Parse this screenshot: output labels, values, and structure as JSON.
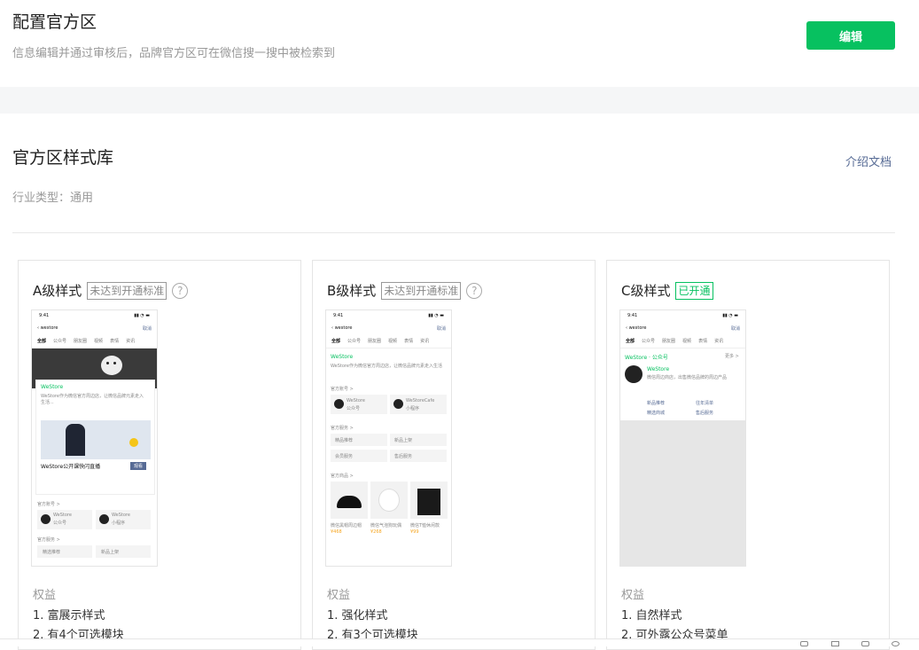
{
  "header": {
    "title": "配置官方区",
    "subtitle": "信息编辑并通过审核后，品牌官方区可在微信搜一搜中被检索到",
    "edit_label": "编辑"
  },
  "library": {
    "title": "官方区样式库",
    "doc_link": "介绍文档",
    "industry": "行业类型：通用"
  },
  "phone": {
    "time": "9:41",
    "nav_back": "westore",
    "nav_cancel": "取消",
    "tabs": [
      "全部",
      "公众号",
      "朋友圈",
      "视频",
      "表情",
      "资讯"
    ]
  },
  "cards": [
    {
      "title": "A级样式",
      "badge": "未达到开通标准",
      "help": "?",
      "rights_label": "权益",
      "rights": [
        "1. 富展示样式",
        "2. 有4个可选模块"
      ],
      "preview": {
        "brand": "WeStore",
        "desc": "WeStore作为微信官方周边店，让微信品牌元素走入生活...",
        "live_title": "WeStore公开课快闪直播",
        "live_btn": "观看",
        "accounts_label": "官方账号 >",
        "account1": "WeStore",
        "account1_sub": "公众号",
        "account2": "WeStore",
        "account2_sub": "小程序",
        "services_label": "官方服务 >",
        "service1": "精选推荐",
        "service2": "新品上架"
      }
    },
    {
      "title": "B级样式",
      "badge": "未达到开通标准",
      "help": "?",
      "rights_label": "权益",
      "rights": [
        "1. 强化样式",
        "2. 有3个可选模块"
      ],
      "preview": {
        "brand": "WeStore",
        "desc": "WeStore作为微信官方周边店，让微信品牌元素走入生活",
        "accounts_label": "官方账号 >",
        "account1": "WeStore",
        "account1_sub": "公众号",
        "account2": "WeStoreCafe",
        "account2_sub": "小程序",
        "services_label": "官方服务 >",
        "service1": "精品推荐",
        "service2": "新品上架",
        "service3": "会员服务",
        "service4": "售后服务",
        "goods_label": "官方商品 >",
        "goods": [
          {
            "name": "微信黑帽周边帽",
            "price": "¥468"
          },
          {
            "name": "微信气泡狗玩偶",
            "price": "¥268"
          },
          {
            "name": "微信T恤休闲款",
            "price": "¥99"
          }
        ]
      }
    },
    {
      "title": "C级样式",
      "badge": "已开通",
      "rights_label": "权益",
      "rights": [
        "1. 自然样式",
        "2. 可外露公众号菜单"
      ],
      "preview": {
        "header": "WeStore · 公众号",
        "more": "更多 >",
        "name": "WeStore",
        "desc": "微信周边商店，出售微信品牌的周边产品",
        "menu": [
          "新品推荐",
          "往年清单",
          "精选商城",
          "售后服务"
        ]
      }
    }
  ]
}
